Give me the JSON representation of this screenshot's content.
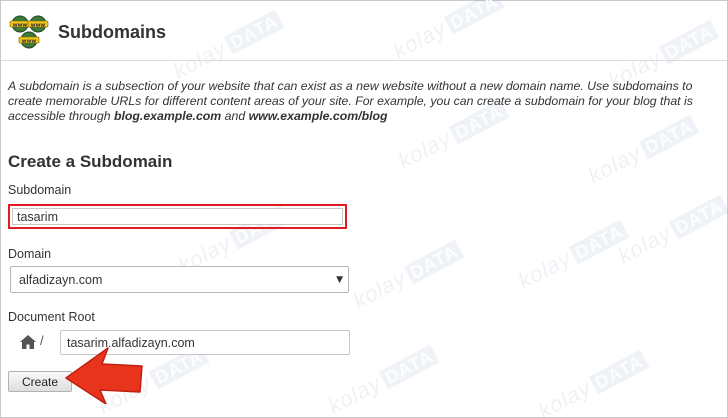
{
  "header": {
    "title": "Subdomains",
    "icon": "www-globes-icon"
  },
  "intro": {
    "text_1": "A subdomain is a subsection of your website that can exist as a new website without a new domain name. Use subdomains to create memorable URLs for different content areas of your site. For example, you can create a subdomain for your blog that is accessible through ",
    "example_1": "blog.example.com",
    "text_2": " and ",
    "example_2": "www.example.com/blog"
  },
  "form": {
    "title": "Create a Subdomain",
    "subdomain_label": "Subdomain",
    "subdomain_value": "tasarim",
    "domain_label": "Domain",
    "domain_value": "alfadizayn.com",
    "docroot_label": "Document Root",
    "docroot_separator": "/",
    "docroot_value": "tasarim.alfadizayn.com",
    "create_label": "Create"
  },
  "watermark": {
    "word": "kolay",
    "badge": "DATA"
  },
  "colors": {
    "highlight_border": "#e01b22",
    "arrow": "#e8341c",
    "watermark": "#7896b4"
  }
}
